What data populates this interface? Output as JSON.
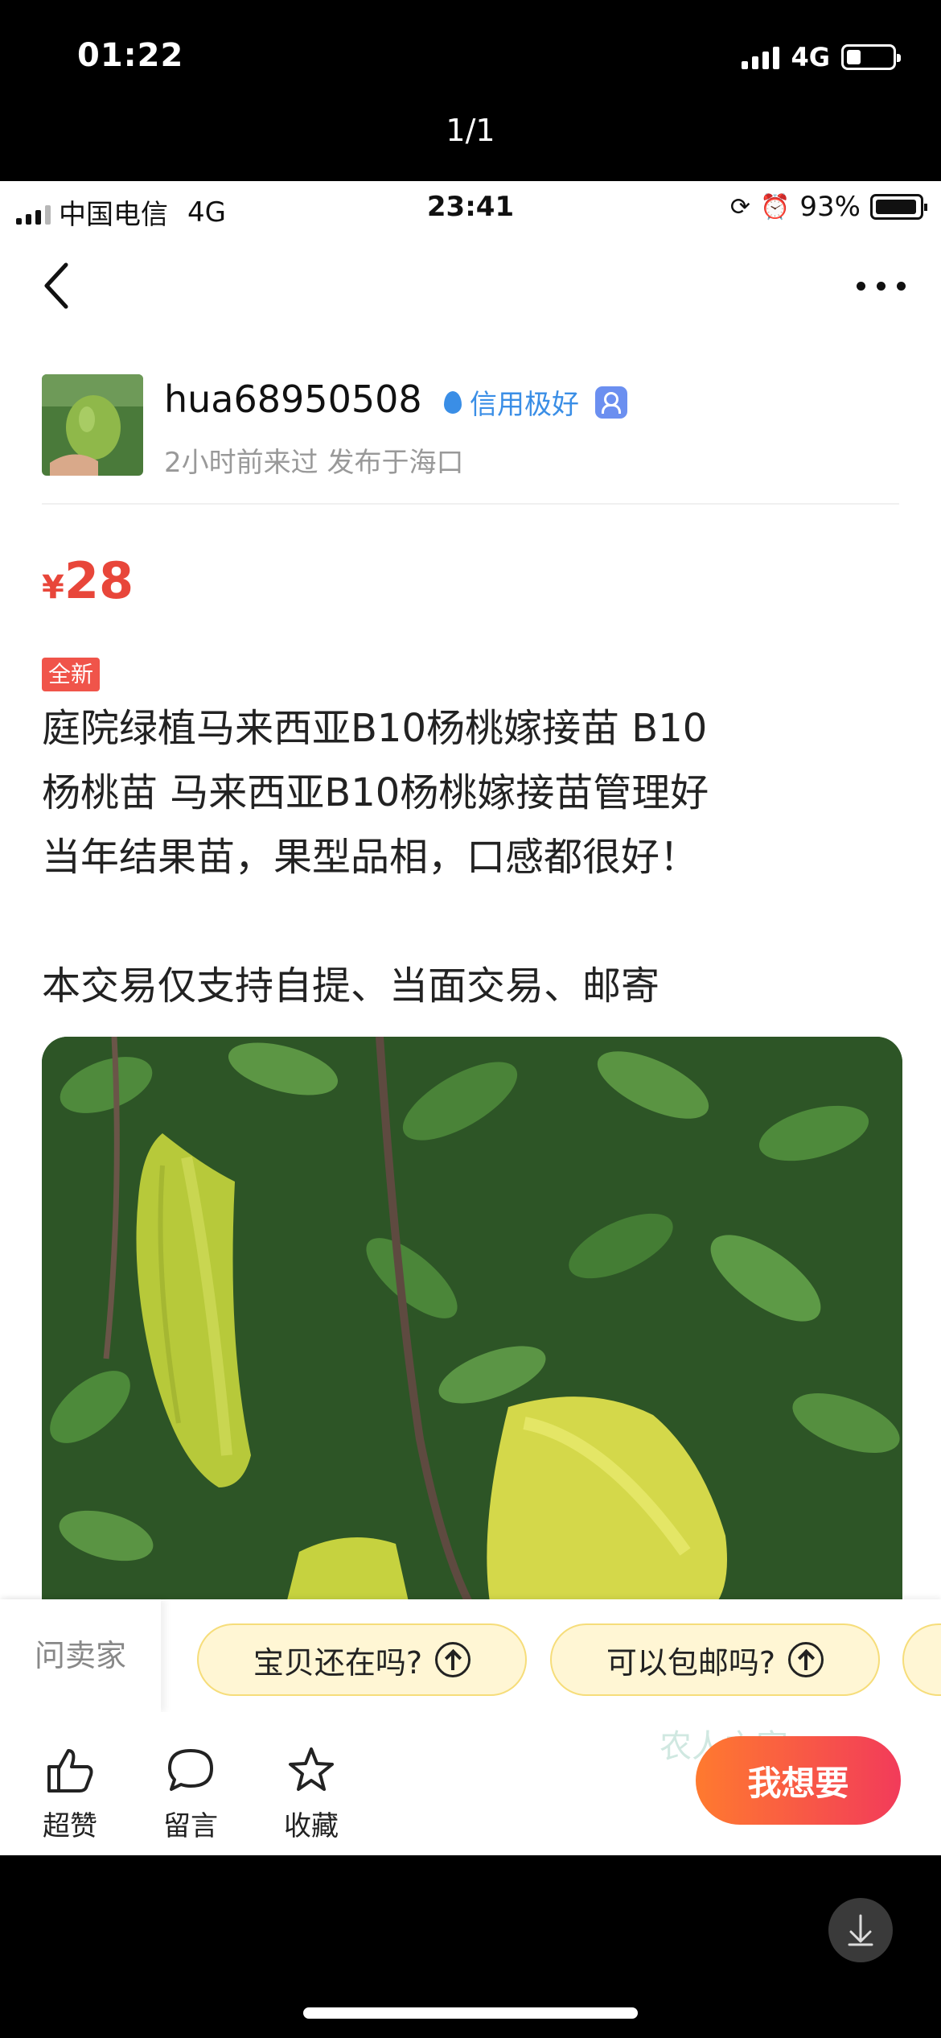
{
  "outer_status": {
    "time": "01:22",
    "network": "4G",
    "battery_level": 0.3
  },
  "viewer": {
    "pager": "1/1"
  },
  "inner_status": {
    "carrier": "中国电信",
    "network": "4G",
    "time": "23:41",
    "battery": "93%",
    "battery_level": 0.93
  },
  "nav": {
    "back_icon": "chevron-left-icon",
    "more_icon": "more-dots-icon"
  },
  "seller": {
    "name": "hua68950508",
    "credit": "信用极好",
    "meta": "2小时前来过 发布于海口"
  },
  "listing": {
    "currency": "¥",
    "price": "28",
    "condition": "全新",
    "description": "庭院绿植马来西亚B10杨桃嫁接苗 B10\n杨桃苗 马来西亚B10杨桃嫁接苗管理好\n当年结果苗，果型品相，口感都很好！\n\n本交易仅支持自提、当面交易、邮寄"
  },
  "ask_bar": {
    "label": "问卖家",
    "chips": [
      "宝贝还在吗?",
      "可以包邮吗?"
    ]
  },
  "actions": {
    "like": "超赞",
    "comment": "留言",
    "favorite": "收藏",
    "want": "我想要"
  },
  "watermark": "农人之家",
  "colors": {
    "price": "#e8463a",
    "credit": "#3a8ee6",
    "tag": "#f0544a",
    "chip_bg": "#fff6d4",
    "want_start": "#ff7a2f",
    "want_end": "#f23b5a"
  }
}
